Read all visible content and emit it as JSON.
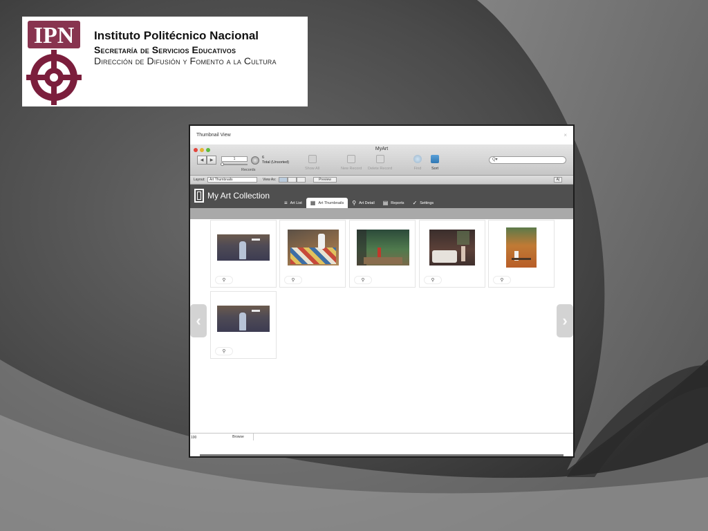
{
  "header": {
    "institution": "Instituto Politécnico Nacional",
    "secretariat_first": "S",
    "secretariat_rest": "ecretaría de ",
    "secretariat_s2": "S",
    "secretariat_rest2": "ervicios ",
    "secretariat_e": "E",
    "secretariat_rest3": "ducativos",
    "direction_d": "D",
    "direction_rest": "irección de ",
    "direction_d2": "D",
    "direction_rest2": "ifusión y ",
    "direction_f": "F",
    "direction_rest3": "omento a la ",
    "direction_c": "C",
    "direction_rest4": "ultura",
    "logo_text": "IPN",
    "logo_color": "#7b1e3c"
  },
  "window": {
    "outer_title": "Thumbnail View",
    "close_glyph": "×",
    "app_title": "MyArt"
  },
  "toolbar": {
    "record_value": "1",
    "total_count": "6",
    "total_label": "Total (Unsorted)",
    "records_label": "Records",
    "show_all": "Show All",
    "new_record": "New Record",
    "delete_record": "Delete Record",
    "find": "Find",
    "sort": "Sort",
    "search_placeholder": "Q▾",
    "prev_glyph": "◀",
    "next_glyph": "▶"
  },
  "layout_bar": {
    "layout_label": "Layout:",
    "layout_value": "Art Thumbnails",
    "view_as_label": "View As:",
    "preview_label": "Preview",
    "aa_label": "A|"
  },
  "app": {
    "brand": "My Art Collection",
    "tabs": [
      {
        "label": "Art List",
        "icon": "list-icon",
        "glyph": "≡"
      },
      {
        "label": "Art Thumbnails",
        "icon": "grid-icon",
        "glyph": "▦"
      },
      {
        "label": "Art Detail",
        "icon": "magnifier-icon",
        "glyph": "⚲"
      },
      {
        "label": "Reports",
        "icon": "document-icon",
        "glyph": "▤"
      },
      {
        "label": "Settings",
        "icon": "checkmark-icon",
        "glyph": "✓"
      }
    ],
    "active_tab": "Art Thumbnails"
  },
  "thumbnails": {
    "zoom_glyph": "⚲",
    "items": [
      {
        "artwork": "painting-figure-birds"
      },
      {
        "artwork": "painting-quilt-figure"
      },
      {
        "artwork": "painting-forest-path"
      },
      {
        "artwork": "painting-bed-figures"
      },
      {
        "artwork": "painting-orange-interior"
      },
      {
        "artwork": "painting-figure-birds"
      }
    ]
  },
  "nav": {
    "prev_glyph": "‹",
    "next_glyph": "›"
  },
  "status": {
    "zoom": "100",
    "mode": "Browse"
  }
}
